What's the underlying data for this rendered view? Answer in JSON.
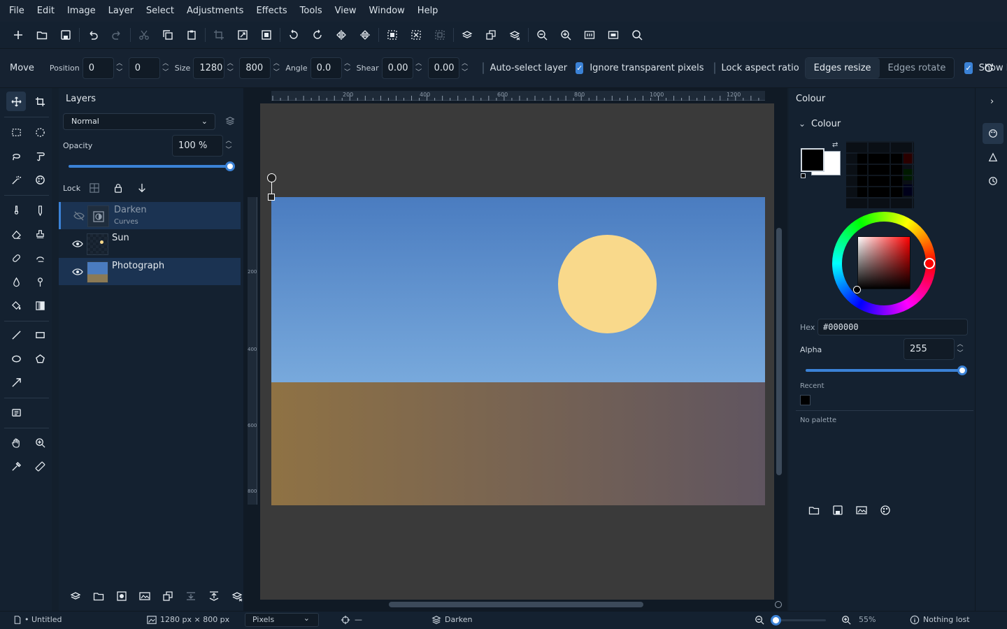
{
  "menu": [
    "File",
    "Edit",
    "Image",
    "Layer",
    "Select",
    "Adjustments",
    "Effects",
    "Tools",
    "View",
    "Window",
    "Help"
  ],
  "options": {
    "tool_name": "Move",
    "position_label": "Position",
    "position_x": "0",
    "position_y": "0",
    "size_label": "Size",
    "size_w": "1280",
    "size_h": "800",
    "angle_label": "Angle",
    "angle": "0.0",
    "shear_label": "Shear",
    "shear_x": "0.00",
    "shear_y": "0.00",
    "auto_select_label": "Auto-select layer",
    "auto_select": false,
    "ignore_transparent_label": "Ignore transparent pixels",
    "ignore_transparent": true,
    "lock_aspect_label": "Lock aspect ratio",
    "lock_aspect": false,
    "edges_resize": "Edges resize",
    "edges_rotate": "Edges rotate",
    "show_handles_label": "Show handles",
    "show_handles": true
  },
  "layers_panel": {
    "title": "Layers",
    "blend_mode": "Normal",
    "opacity_label": "Opacity",
    "opacity_value": "100 %",
    "opacity": 1.0,
    "lock_label": "Lock",
    "layers": [
      {
        "name": "Darken",
        "sub": "Curves",
        "visible": false,
        "selected": true
      },
      {
        "name": "Sun",
        "sub": "",
        "visible": true,
        "selected": false
      },
      {
        "name": "Photograph",
        "sub": "",
        "visible": true,
        "selected": true
      }
    ]
  },
  "ruler": {
    "h_ticks": [
      "200",
      "400",
      "600",
      "800",
      "1000",
      "1200"
    ],
    "v_ticks": [
      "200",
      "400",
      "600",
      "800"
    ]
  },
  "colour_panel": {
    "title": "Colour",
    "section": "Colour",
    "hex_label": "Hex",
    "hex_value": "#000000",
    "alpha_label": "Alpha",
    "alpha_value": "255",
    "alpha": 1.0,
    "recent_label": "Recent",
    "palette_text": "No palette",
    "primary_color": "#000000",
    "secondary_color": "#ffffff"
  },
  "status": {
    "document": "• Untitled",
    "image_size": "1280 px × 800 px",
    "units": "Pixels",
    "cursor": "—",
    "active_layer": "Darken",
    "zoom": "55%",
    "history": "Nothing lost"
  },
  "colors": {
    "accent": "#3b82d6",
    "sky_top": "#4a7cc0",
    "sky_bottom": "#78a9dc",
    "sun": "#f9d98b",
    "ground_left": "#8f7244",
    "ground_right": "#605560"
  }
}
